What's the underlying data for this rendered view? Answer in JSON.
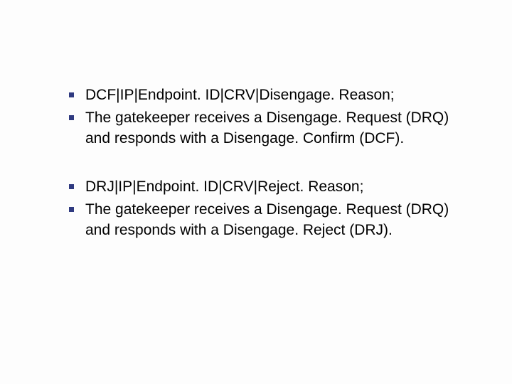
{
  "groups": [
    {
      "items": [
        {
          "text": "DCF|IP|Endpoint. ID|CRV|Disengage. Reason;"
        },
        {
          "text": "The gatekeeper receives a Disengage. Request (DRQ) and responds with a Disengage. Confirm (DCF)."
        }
      ]
    },
    {
      "items": [
        {
          "text": "DRJ|IP|Endpoint. ID|CRV|Reject. Reason;"
        },
        {
          "text": "The gatekeeper receives a Disengage. Request (DRQ) and responds with a Disengage. Reject (DRJ)."
        }
      ]
    }
  ]
}
